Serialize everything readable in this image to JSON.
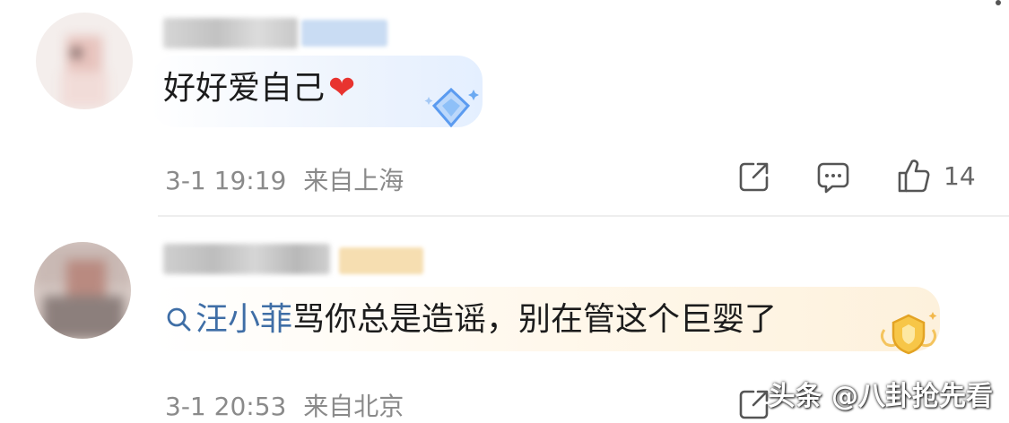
{
  "comments": [
    {
      "text": "好好爱自己",
      "emoji": "❤",
      "date": "3-1 19:19",
      "location": "来自上海",
      "like_count": "14",
      "badge_icon": "diamond-badge"
    },
    {
      "mention_icon": "search-icon",
      "mention": "汪小菲",
      "text": "骂你总是造谣，别在管这个巨婴了",
      "date": "3-1 20:53",
      "location": "来自北京",
      "like_count": "",
      "badge_icon": "gold-shield-badge"
    }
  ],
  "watermark": "头条 @八卦抢先看",
  "colors": {
    "mention": "#3f6ea6",
    "meta": "#8a8a8a",
    "heart": "#e8332f"
  }
}
